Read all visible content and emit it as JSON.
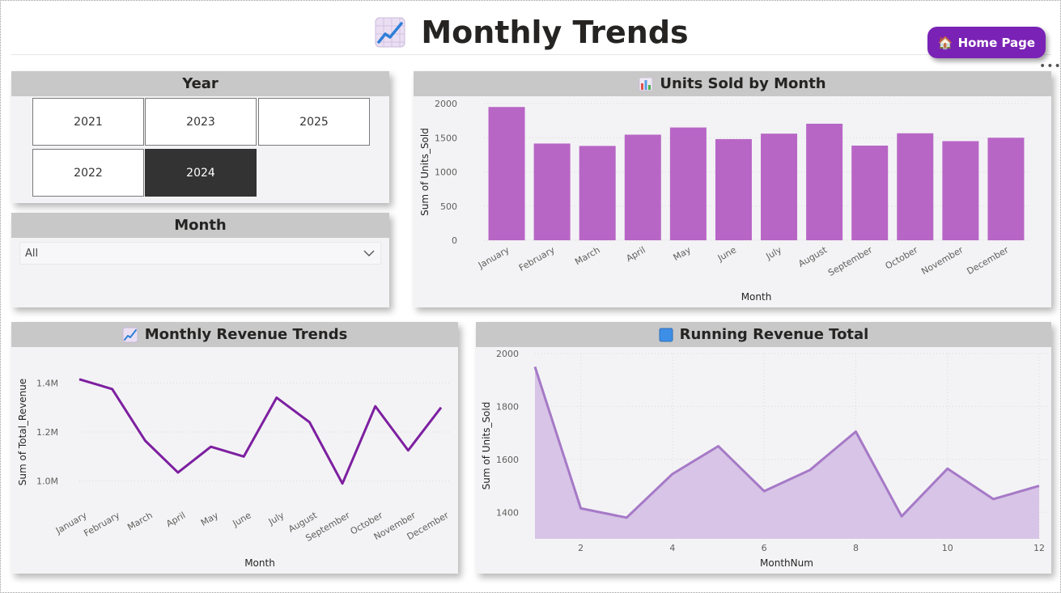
{
  "header": {
    "title": "Monthly Trends",
    "title_icon": "chart-increasing-icon",
    "home_button": {
      "icon": "house-icon",
      "label": "Home Page"
    }
  },
  "colors": {
    "accent": "#7a22b5",
    "bar": "#b866c6",
    "line": "#7d1fa0",
    "area_line": "#a679c7",
    "area_fill": "#d7c4e6",
    "panel_bg": "#f3f3f5",
    "panel_header": "#c8c8c8",
    "selected_tile": "#333333"
  },
  "year_slicer": {
    "title": "Year",
    "options": [
      {
        "label": "2021",
        "selected": false
      },
      {
        "label": "2023",
        "selected": false
      },
      {
        "label": "2025",
        "selected": false
      },
      {
        "label": "2022",
        "selected": false
      },
      {
        "label": "2024",
        "selected": true
      }
    ]
  },
  "month_slicer": {
    "title": "Month",
    "value": "All"
  },
  "units_chart": {
    "title": "Units Sold by Month",
    "title_icon": "bar-chart-icon",
    "chart_data": {
      "type": "bar",
      "title": "Units Sold by Month",
      "xlabel": "Month",
      "ylabel": "Sum of Units_Sold",
      "categories": [
        "January",
        "February",
        "March",
        "April",
        "May",
        "June",
        "July",
        "August",
        "September",
        "October",
        "November",
        "December"
      ],
      "values": [
        1950,
        1415,
        1380,
        1545,
        1650,
        1480,
        1560,
        1705,
        1385,
        1565,
        1450,
        1500
      ],
      "ylim": [
        0,
        2000
      ],
      "yticks": [
        "0",
        "500",
        "1000",
        "1500",
        "2000"
      ],
      "grid": true
    }
  },
  "revenue_chart": {
    "title": "Monthly Revenue Trends",
    "title_icon": "chart-increasing-icon",
    "chart_data": {
      "type": "line",
      "title": "Monthly Revenue Trends",
      "xlabel": "Month",
      "ylabel": "Sum of Total_Revenue",
      "categories": [
        "January",
        "February",
        "March",
        "April",
        "May",
        "June",
        "July",
        "August",
        "September",
        "October",
        "November",
        "December"
      ],
      "values": [
        1415000,
        1375000,
        1165000,
        1035000,
        1140000,
        1100000,
        1340000,
        1240000,
        990000,
        1305000,
        1125000,
        1300000
      ],
      "ylim": [
        900000,
        1500000
      ],
      "yticks": [
        {
          "v": 1000000,
          "label": "1.0M"
        },
        {
          "v": 1200000,
          "label": "1.2M"
        },
        {
          "v": 1400000,
          "label": "1.4M"
        }
      ],
      "grid": true
    }
  },
  "running_chart": {
    "title": "Running Revenue Total",
    "title_icon": "blue-square-icon",
    "chart_data": {
      "type": "area",
      "title": "Running Revenue Total",
      "xlabel": "MonthNum",
      "ylabel": "Sum of Units_Sold",
      "x": [
        1,
        2,
        3,
        4,
        5,
        6,
        7,
        8,
        9,
        10,
        11,
        12
      ],
      "values": [
        1950,
        1415,
        1380,
        1545,
        1650,
        1480,
        1560,
        1705,
        1385,
        1565,
        1450,
        1500
      ],
      "xlim": [
        1,
        12
      ],
      "ylim": [
        1300,
        2000
      ],
      "xticks": [
        "2",
        "4",
        "6",
        "8",
        "10",
        "12"
      ],
      "yticks": [
        "1400",
        "1600",
        "1800",
        "2000"
      ],
      "grid": true
    }
  }
}
